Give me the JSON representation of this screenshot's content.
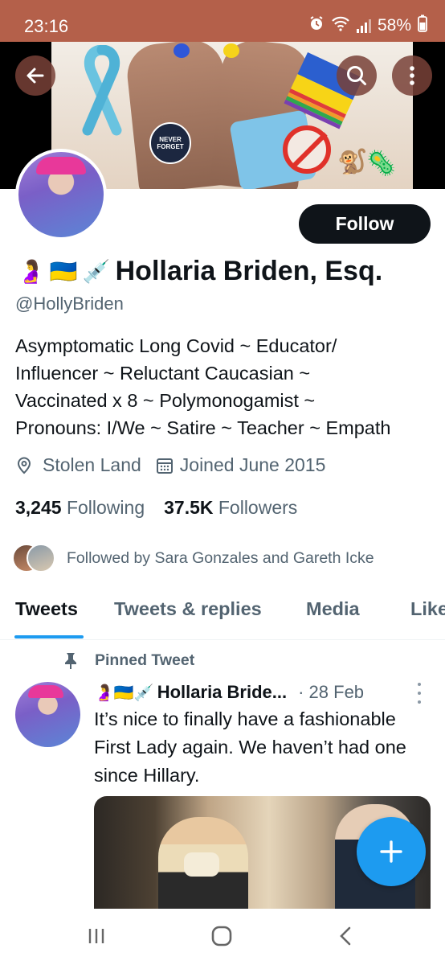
{
  "status_bar": {
    "time": "23:16",
    "battery": "58%",
    "icons": [
      "alarm-icon",
      "wifi-icon",
      "signal-icon",
      "battery-icon"
    ]
  },
  "banner": {
    "badge_line1": "NEVER",
    "badge_line2": "FORGET",
    "emoji_monkey": "🐒",
    "emoji_virus": "🦠",
    "icons": [
      "back-arrow-icon",
      "search-icon",
      "more-vertical-icon"
    ]
  },
  "profile": {
    "follow_label": "Follow",
    "name_emojis": [
      "🤰",
      "🇺🇦",
      "💉"
    ],
    "display_name": "Hollaria Briden, Esq.",
    "handle": "@HollyBriden",
    "bio_lines": [
      "Asymptomatic Long Covid ~ Educator/",
      "Influencer ~ Reluctant Caucasian ~",
      "Vaccinated x 8 ~ Polymonogamist ~",
      "Pronouns: I/We ~ Satire ~ Teacher ~ Empath"
    ],
    "location": "Stolen Land",
    "joined": "Joined June 2015",
    "following_count": "3,245",
    "following_label": "Following",
    "followers_count": "37.5K",
    "followers_label": "Followers",
    "followed_by": "Followed by Sara Gonzales and Gareth Icke"
  },
  "tabs": [
    {
      "label": "Tweets",
      "active": true
    },
    {
      "label": "Tweets & replies",
      "active": false
    },
    {
      "label": "Media",
      "active": false
    },
    {
      "label": "Likes",
      "active": false
    }
  ],
  "pinned_tweet": {
    "pinned_label": "Pinned Tweet",
    "author_emojis": "🤰🇺🇦💉",
    "author_name": "Hollaria Bride...",
    "date": "· 28 Feb",
    "text_lines": [
      "It’s nice to finally have a fashionable",
      "First Lady again. We haven’t had one",
      "since Hillary."
    ]
  },
  "colors": {
    "status_bar": "#b4604a",
    "accent": "#1d9bf0",
    "text_primary": "#0f1419",
    "text_secondary": "#536471"
  }
}
